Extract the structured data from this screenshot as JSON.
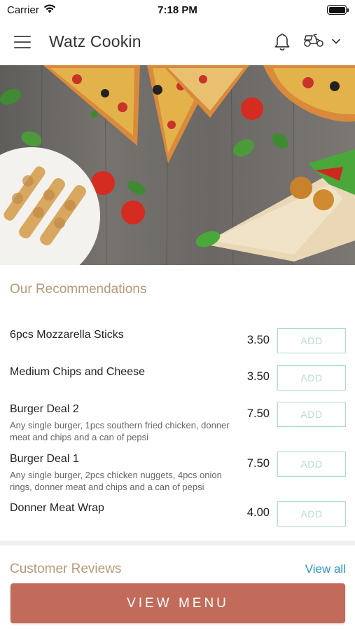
{
  "status_bar": {
    "carrier": "Carrier",
    "time": "7:18 PM"
  },
  "header": {
    "title": "Watz Cookin",
    "icons": [
      "menu-icon",
      "bell-icon",
      "scooter-icon",
      "chevron-down-icon"
    ]
  },
  "hero": {
    "image": "food-banner-pizza-skewers-wrap"
  },
  "recommendations": {
    "title": "Our Recommendations",
    "add_label": "ADD",
    "items": [
      {
        "name": "6pcs Mozzarella Sticks",
        "description": "",
        "price": "3.50"
      },
      {
        "name": "Medium Chips and Cheese",
        "description": "",
        "price": "3.50"
      },
      {
        "name": "Burger Deal 2",
        "description": "Any single burger, 1pcs southern fried chicken, donner meat and chips and a can of pepsi",
        "price": "7.50"
      },
      {
        "name": "Burger Deal 1",
        "description": "Any single burger, 2pcs chicken nuggets, 4pcs onion rings, donner meat and chips and a can of pepsi",
        "price": "7.50"
      },
      {
        "name": "Donner Meat Wrap",
        "description": "",
        "price": "4.00"
      }
    ]
  },
  "reviews": {
    "title": "Customer Reviews",
    "view_all": "View all"
  },
  "cta": {
    "label": "VIEW MENU"
  },
  "colors": {
    "accent_tan": "#b59a78",
    "add_border": "#a9dec8",
    "link_blue": "#2b97c5",
    "cta_bg": "#c26b5a"
  }
}
